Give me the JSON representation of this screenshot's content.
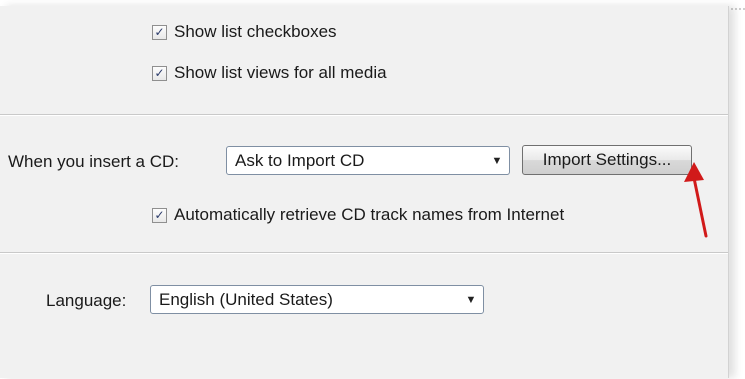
{
  "options": {
    "show_list_checkboxes": {
      "label": "Show list checkboxes",
      "checked": true
    },
    "show_list_views": {
      "label": "Show list views for all media",
      "checked": true
    }
  },
  "cd": {
    "label": "When you insert a CD:",
    "action_value": "Ask to Import CD",
    "import_settings_label": "Import Settings...",
    "retrieve_names": {
      "label": "Automatically retrieve CD track names from Internet",
      "checked": true
    }
  },
  "language": {
    "label": "Language:",
    "value": "English (United States)"
  },
  "icons": {
    "checkbox_mark": "✓",
    "dropdown": "▼"
  },
  "colors": {
    "annotation_arrow": "#d11a1a"
  }
}
